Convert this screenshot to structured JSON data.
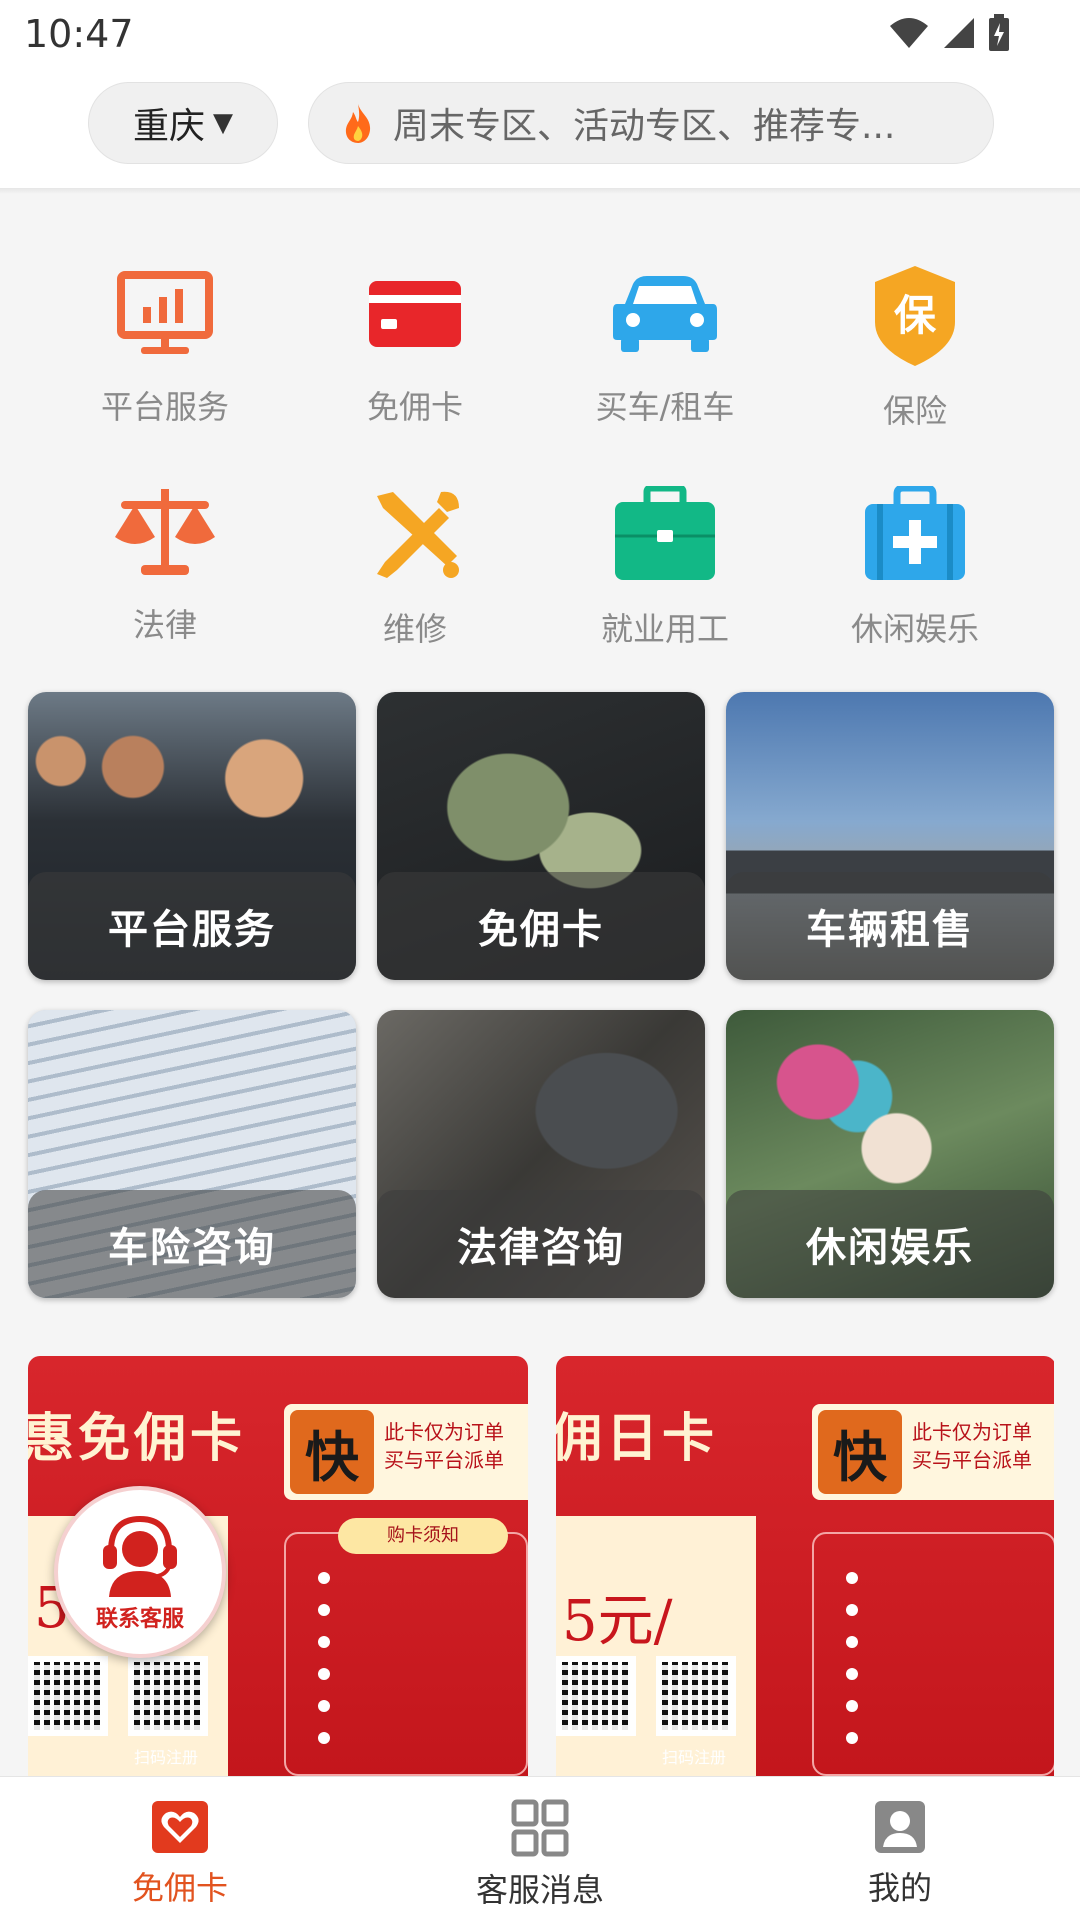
{
  "status_bar": {
    "time": "10:47"
  },
  "header": {
    "city": "重庆",
    "search_placeholder": "周末专区、活动专区、推荐专..."
  },
  "grid": [
    {
      "label": "平台服务",
      "icon": "monitor-chart-icon",
      "color": "#f06a3c"
    },
    {
      "label": "免佣卡",
      "icon": "card-icon",
      "color": "#e8262a"
    },
    {
      "label": "买车/租车",
      "icon": "car-icon",
      "color": "#2ea7ea"
    },
    {
      "label": "保险",
      "icon": "shield-icon",
      "color": "#f5a623",
      "icon_text": "保"
    },
    {
      "label": "法律",
      "icon": "scale-icon",
      "color": "#f06a3c"
    },
    {
      "label": "维修",
      "icon": "tools-icon",
      "color": "#f5a623"
    },
    {
      "label": "就业用工",
      "icon": "briefcase-icon",
      "color": "#12b886"
    },
    {
      "label": "休闲娱乐",
      "icon": "medkit-icon",
      "color": "#2ea7ea"
    }
  ],
  "cards": [
    {
      "label": "平台服务"
    },
    {
      "label": "免佣卡"
    },
    {
      "label": "车辆租售"
    },
    {
      "label": "车险咨询"
    },
    {
      "label": "法律咨询"
    },
    {
      "label": "休闲娱乐"
    }
  ],
  "promos": [
    {
      "title": "惠免佣卡",
      "badge": "快",
      "note": "此卡仅为订单 买与平台派单",
      "price": "5",
      "notice": "购卡须知",
      "qr_caption": "扫码注册"
    },
    {
      "title": "佣日卡",
      "badge": "快",
      "note": "此卡仅为订单 买与平台派单",
      "price": "5元/",
      "notice": "",
      "qr_caption": "扫码注册"
    }
  ],
  "fab": {
    "label": "联系客服",
    "icon": "customer-service-icon"
  },
  "bottom_nav": [
    {
      "label": "免佣卡",
      "icon": "card-heart-icon",
      "active": true
    },
    {
      "label": "客服消息",
      "icon": "grid-icon",
      "active": false
    },
    {
      "label": "我的",
      "icon": "user-icon",
      "active": false
    }
  ],
  "colors": {
    "accent": "#e2531f",
    "promo_red": "#d8262c"
  }
}
